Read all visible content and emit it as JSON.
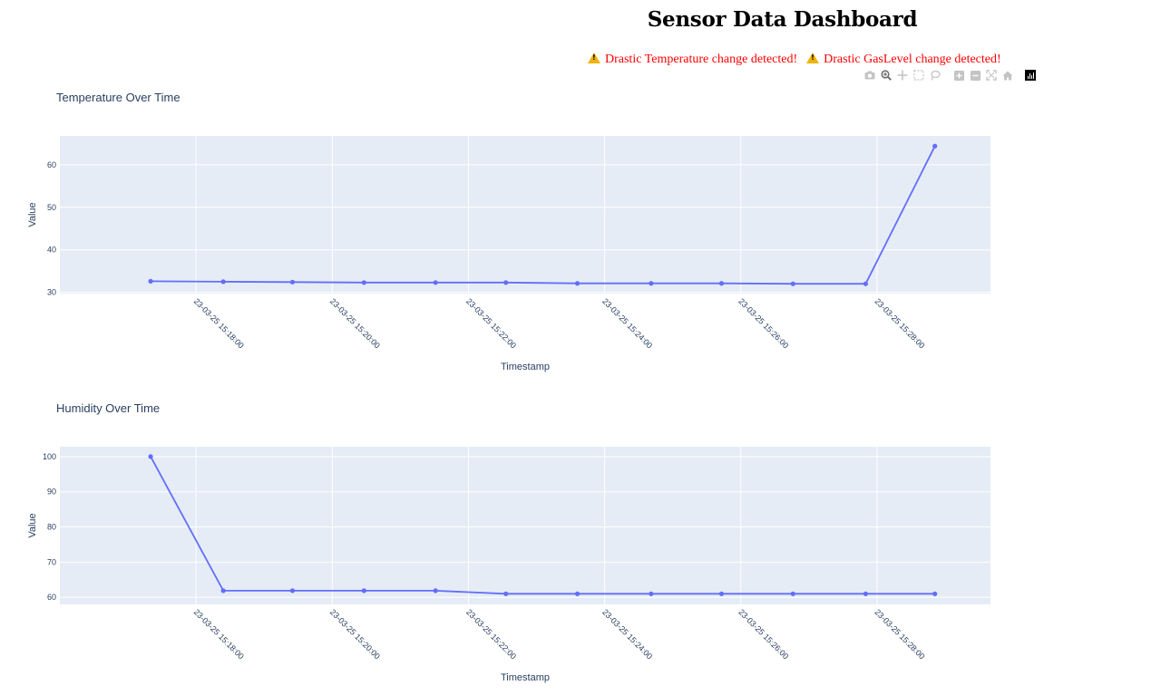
{
  "page": {
    "title": "Sensor Data Dashboard",
    "alerts": [
      "Drastic Temperature change detected!",
      "Drastic GasLevel change detected!"
    ]
  },
  "modebar": {
    "buttons": [
      "camera-icon",
      "zoom-icon",
      "pan-icon",
      "box-select-icon",
      "lasso-icon",
      "zoom-in-icon",
      "zoom-out-icon",
      "autoscale-icon",
      "home-icon"
    ],
    "logo": "plotly-logo-icon"
  },
  "colors": {
    "line": "#636efa",
    "plot_bg": "#e5ecf6",
    "grid": "#ffffff",
    "text": "#2a3f5f",
    "alert": "#ff0000"
  },
  "chart_data": [
    {
      "type": "line",
      "title": "Temperature Over Time",
      "xlabel": "Timestamp",
      "ylabel": "Value",
      "ylim": [
        29.7,
        66.8
      ],
      "yticks": [
        30,
        40,
        50,
        60
      ],
      "grid": true,
      "xticks": [
        "23-03-25 15:18:00",
        "23-03-25 15:20:00",
        "23-03-25 15:22:00",
        "23-03-25 15:24:00",
        "23-03-25 15:26:00",
        "23-03-25 15:28:00"
      ],
      "x": [
        "23-03-25 15:17:20",
        "23-03-25 15:18:24",
        "23-03-25 15:19:25",
        "23-03-25 15:20:28",
        "23-03-25 15:21:31",
        "23-03-25 15:22:33",
        "23-03-25 15:23:36",
        "23-03-25 15:24:41",
        "23-03-25 15:25:43",
        "23-03-25 15:26:46",
        "23-03-25 15:27:50",
        "23-03-25 15:28:51"
      ],
      "y": [
        32.6,
        32.5,
        32.4,
        32.3,
        32.3,
        32.3,
        32.1,
        32.1,
        32.1,
        32.0,
        32.0,
        64.4
      ]
    },
    {
      "type": "line",
      "title": "Humidity Over Time",
      "xlabel": "Timestamp",
      "ylabel": "Value",
      "ylim": [
        58.0,
        102.8
      ],
      "yticks": [
        60,
        70,
        80,
        90,
        100
      ],
      "grid": true,
      "xticks": [
        "23-03-25 15:18:00",
        "23-03-25 15:20:00",
        "23-03-25 15:22:00",
        "23-03-25 15:24:00",
        "23-03-25 15:26:00",
        "23-03-25 15:28:00"
      ],
      "x": [
        "23-03-25 15:17:20",
        "23-03-25 15:18:24",
        "23-03-25 15:19:25",
        "23-03-25 15:20:28",
        "23-03-25 15:21:31",
        "23-03-25 15:22:33",
        "23-03-25 15:23:36",
        "23-03-25 15:24:41",
        "23-03-25 15:25:43",
        "23-03-25 15:26:46",
        "23-03-25 15:27:50",
        "23-03-25 15:28:51"
      ],
      "y": [
        100.0,
        61.9,
        61.9,
        61.9,
        61.9,
        61.0,
        61.0,
        61.0,
        61.0,
        61.0,
        61.0,
        61.0
      ]
    }
  ]
}
